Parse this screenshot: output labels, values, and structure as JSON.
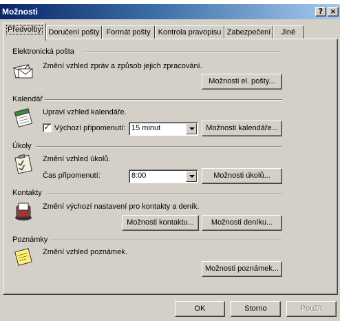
{
  "window": {
    "title": "Možnosti",
    "help_glyph": "?",
    "close_glyph": "×"
  },
  "tabs": [
    {
      "label": "Předvolby",
      "active": true
    },
    {
      "label": "Doručení pošty"
    },
    {
      "label": "Formát pošty"
    },
    {
      "label": "Kontrola pravopisu"
    },
    {
      "label": "Zabezpečení"
    },
    {
      "label": "Jiné"
    }
  ],
  "sections": {
    "email": {
      "title": "Elektronická pošta",
      "description": "Změní vzhled zpráv a způsob jejich zpracování.",
      "button": "Možnosti el. pošty...",
      "icon": "mail-envelope-icon"
    },
    "calendar": {
      "title": "Kalendář",
      "description": "Upraví vzhled kalendáře.",
      "reminder_checkbox_label": "Výchozí připomenutí:",
      "reminder_checked": true,
      "check_glyph": "✓",
      "reminder_value": "15 minut",
      "button": "Možnosti kalendáře...",
      "icon": "calendar-icon"
    },
    "tasks": {
      "title": "Úkoly",
      "description": "Změní vzhled úkolů.",
      "reminder_time_label": "Čas připomenutí:",
      "reminder_time_value": "8:00",
      "button": "Možnosti úkolů...",
      "icon": "task-clipboard-icon"
    },
    "contacts": {
      "title": "Kontakty",
      "description": "Změní výchozí nastavení pro kontakty a deník.",
      "contact_button": "Možnosti kontaktu...",
      "journal_button": "Možnosti deníku...",
      "icon": "rolodex-icon"
    },
    "notes": {
      "title": "Poznámky",
      "description": "Změní vzhled poznámek.",
      "button": "Možnosti poznámek...",
      "icon": "sticky-note-icon"
    }
  },
  "footer": {
    "ok": "OK",
    "cancel": "Storno",
    "apply": "Použít"
  },
  "colors": {
    "face": "#d4d0c8",
    "title_active_start": "#0a246a",
    "title_active_end": "#a6caf0"
  }
}
